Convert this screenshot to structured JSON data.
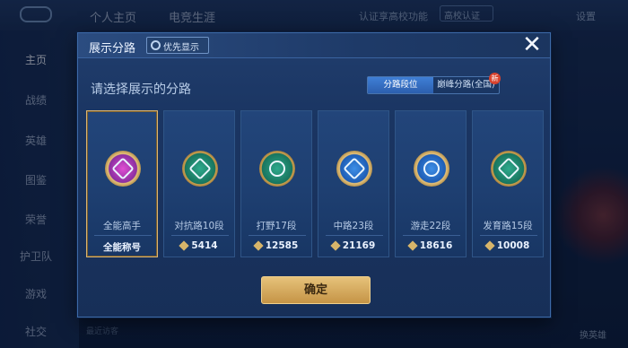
{
  "topnav": {
    "home": "个人主页",
    "esports": "电竞生涯"
  },
  "topright": {
    "invite": "认证享高校功能",
    "campus_badge": "高校认证",
    "settings": "设置"
  },
  "sidebar": {
    "items": [
      {
        "label": "主页",
        "active": true
      },
      {
        "label": "战绩",
        "active": false
      },
      {
        "label": "英雄",
        "active": false
      },
      {
        "label": "图鉴",
        "active": false
      },
      {
        "label": "荣誉",
        "active": false
      },
      {
        "label": "护卫队",
        "active": false
      },
      {
        "label": "游戏",
        "active": false
      },
      {
        "label": "社交",
        "active": false
      }
    ]
  },
  "bottombar": {
    "recent": "最近访客"
  },
  "switch_label": "换英雄",
  "dialog": {
    "title": "展示分路",
    "pref_button": "优先显示",
    "prompt": "请选择展示的分路",
    "segment": {
      "left": "分路段位",
      "right": "巅峰分路(全国)",
      "new_tag": "新"
    },
    "cards": [
      {
        "rank": "全能高手",
        "score": "全能称号",
        "emblem": "allround-emblem",
        "selected": true
      },
      {
        "rank": "对抗路10段",
        "score": "5414",
        "emblem": "clash-lane-emblem",
        "selected": false
      },
      {
        "rank": "打野17段",
        "score": "12585",
        "emblem": "jungle-emblem",
        "selected": false
      },
      {
        "rank": "中路23段",
        "score": "21169",
        "emblem": "mid-lane-emblem",
        "selected": false
      },
      {
        "rank": "游走22段",
        "score": "18616",
        "emblem": "roam-emblem",
        "selected": false
      },
      {
        "rank": "发育路15段",
        "score": "10008",
        "emblem": "farm-lane-emblem",
        "selected": false
      }
    ],
    "confirm": "确定"
  },
  "colors": {
    "accent_gold": "#d9b575",
    "segment_active": "#3f7fd6",
    "dialog_bg": "#1a3562"
  }
}
